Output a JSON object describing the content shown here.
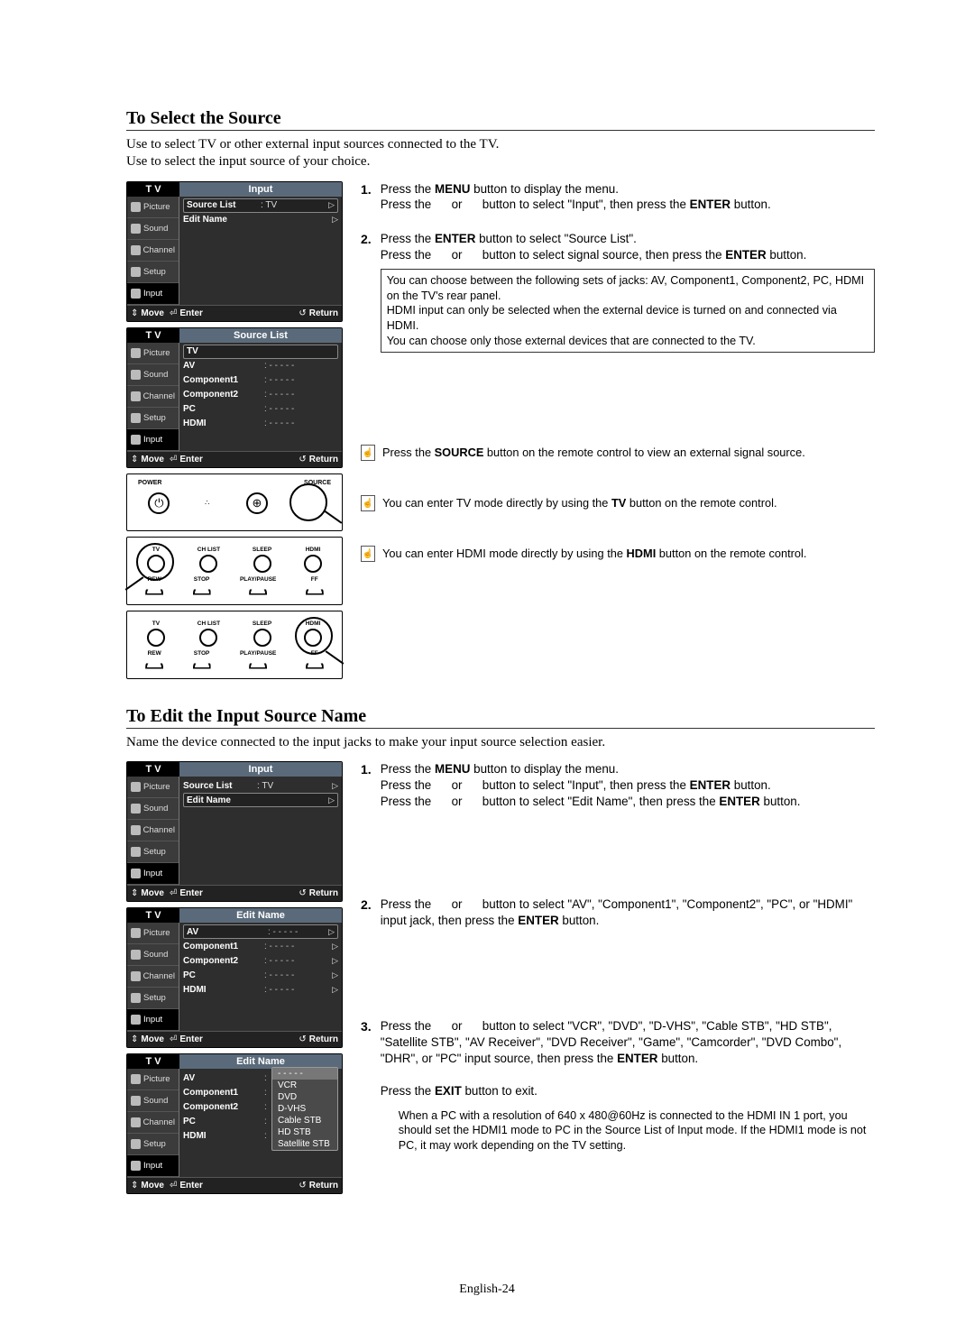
{
  "page_number": "English-24",
  "section1": {
    "heading": "To Select the Source",
    "intro_line1": "Use to select TV or other external input sources connected to the TV.",
    "intro_line2": "Use to select the input source of your choice.",
    "steps": [
      {
        "num": "1.",
        "lines": [
          "Press the <b>MENU</b> button to display the menu.",
          "Press the&nbsp;&nbsp;&nbsp;&nbsp;&nbsp;&nbsp;or&nbsp;&nbsp;&nbsp;&nbsp;&nbsp;&nbsp;button to select \"Input\", then press the <b>ENTER</b> button."
        ]
      },
      {
        "num": "2.",
        "lines": [
          "Press the <b>ENTER</b> button to select \"Source List\".",
          "Press the&nbsp;&nbsp;&nbsp;&nbsp;&nbsp;&nbsp;or&nbsp;&nbsp;&nbsp;&nbsp;&nbsp;&nbsp;button to select signal source, then press the <b>ENTER</b> button."
        ],
        "note": [
          "You can choose between the following sets of jacks: AV, Component1, Component2, PC, HDMI on the TV's rear panel.",
          "HDMI input can only be selected when the external device is turned on and connected via HDMI.",
          "You can choose only those external devices that are connected to the TV."
        ]
      }
    ],
    "hints": [
      "Press the <b>SOURCE</b> button on the remote control to view an external signal source.",
      "You can enter TV mode directly by using the <b>TV</b> button on the remote control.",
      "You can enter HDMI mode directly by using the <b>HDMI</b> button on the remote control."
    ]
  },
  "section2": {
    "heading": "To Edit the Input Source Name",
    "intro": "Name the device connected to the input jacks to make your input source selection easier.",
    "steps": [
      {
        "num": "1.",
        "lines": [
          "Press the <b>MENU</b> button to display the menu.",
          "Press the&nbsp;&nbsp;&nbsp;&nbsp;&nbsp;&nbsp;or&nbsp;&nbsp;&nbsp;&nbsp;&nbsp;&nbsp;button to select \"Input\", then press the <b>ENTER</b> button.",
          "Press the&nbsp;&nbsp;&nbsp;&nbsp;&nbsp;&nbsp;or&nbsp;&nbsp;&nbsp;&nbsp;&nbsp;&nbsp;button to select \"Edit Name\", then press the <b>ENTER</b> button."
        ]
      },
      {
        "num": "2.",
        "lines": [
          "Press the&nbsp;&nbsp;&nbsp;&nbsp;&nbsp;&nbsp;or&nbsp;&nbsp;&nbsp;&nbsp;&nbsp;&nbsp;button to select \"AV\", \"Component1\", \"Component2\", \"PC\", or \"HDMI\" input jack, then press the <b>ENTER</b> button."
        ]
      },
      {
        "num": "3.",
        "lines": [
          "Press the&nbsp;&nbsp;&nbsp;&nbsp;&nbsp;&nbsp;or&nbsp;&nbsp;&nbsp;&nbsp;&nbsp;&nbsp;button to select \"VCR\", \"DVD\", \"D-VHS\", \"Cable STB\", \"HD STB\", \"Satellite STB\", \"AV Receiver\", \"DVD Receiver\", \"Game\", \"Camcorder\", \"DVD Combo\", \"DHR\", or \"PC\" input source, then press the <b>ENTER</b> button.",
          "Press the <b>EXIT</b> button to exit."
        ],
        "note": [
          "When a PC with a resolution of 640 x 480@60Hz is connected to the HDMI IN 1 port, you should set the HDMI1 mode to PC in the Source List of Input mode. If the HDMI1 mode is not PC, it may work depending on the TV setting."
        ]
      }
    ]
  },
  "osd": {
    "brand": "T V",
    "nav": {
      "picture": "Picture",
      "sound": "Sound",
      "channel": "Channel",
      "setup": "Setup",
      "input": "Input"
    },
    "foot": {
      "move": "Move",
      "enter": "Enter",
      "return": "Return"
    },
    "input_menu": {
      "title": "Input",
      "source_list": "Source List",
      "source_list_val": ": TV",
      "edit_name": "Edit Name"
    },
    "source_list": {
      "title": "Source List",
      "items": [
        "TV",
        "AV",
        "Component1",
        "Component2",
        "PC",
        "HDMI"
      ],
      "dashes": ": - - - - -"
    },
    "edit_name": {
      "title": "Edit Name",
      "items": [
        "AV",
        "Component1",
        "Component2",
        "PC",
        "HDMI"
      ],
      "dashes": ": - - - - -",
      "dropdown_sel": "- - - - -",
      "dropdown": [
        "VCR",
        "DVD",
        "D-VHS",
        "Cable STB",
        "HD STB",
        "Satellite STB"
      ]
    }
  },
  "remote": {
    "top": {
      "power": "POWER",
      "source": "SOURCE"
    },
    "row2": {
      "tv": "TV",
      "chlist": "CH LIST",
      "sleep": "SLEEP",
      "hdmi": "HDMI"
    },
    "row3": {
      "rew": "REW",
      "stop": "STOP",
      "play": "PLAY/PAUSE",
      "ff": "FF"
    }
  }
}
